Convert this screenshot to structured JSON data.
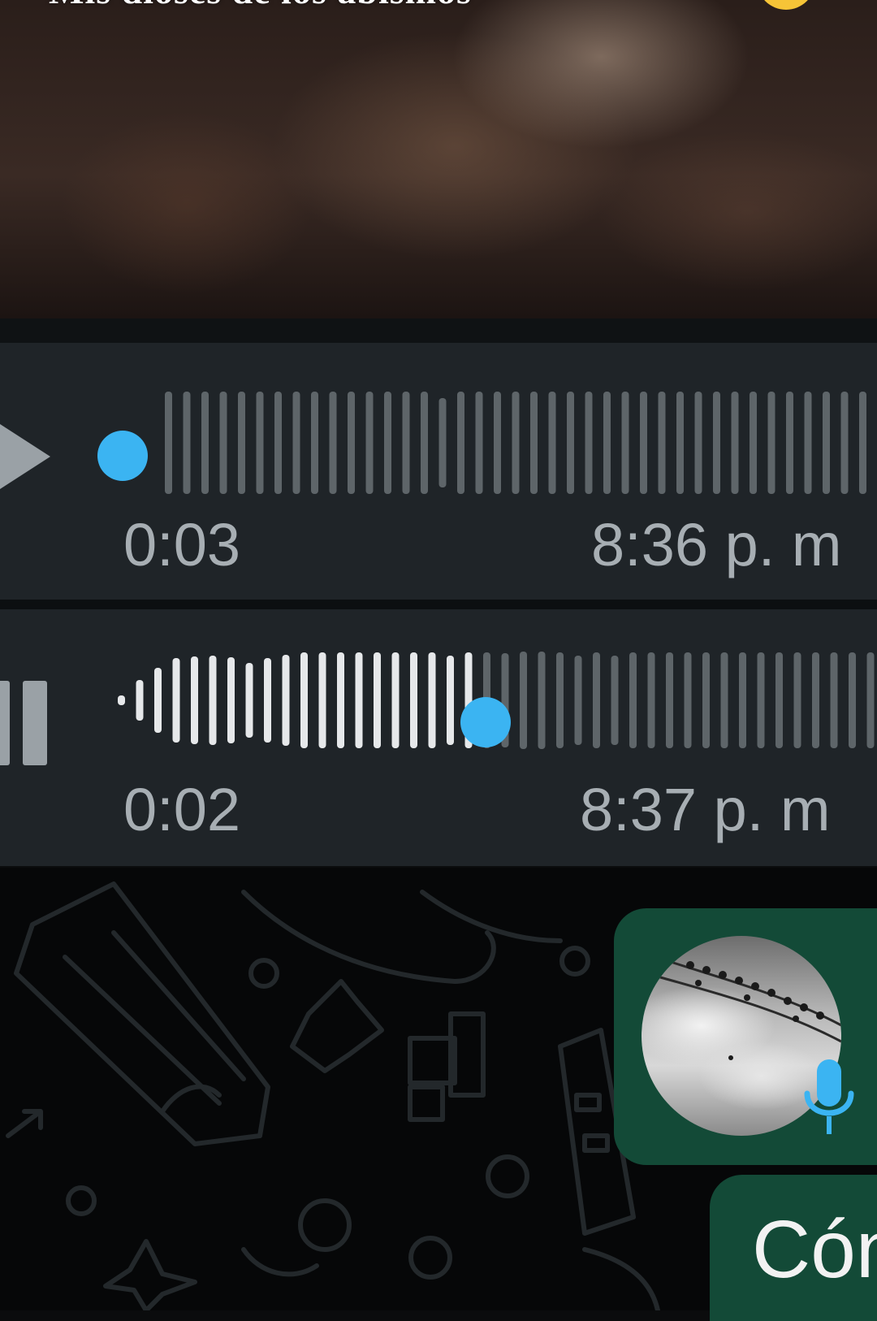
{
  "video_caption": {
    "text": "Mis dioses de los abismos",
    "emoji": "grinning-face-emoji"
  },
  "messages": [
    {
      "kind": "voice",
      "state": "paused",
      "duration": "0:03",
      "time": "8:36 p. m",
      "progress": 0.0
    },
    {
      "kind": "voice",
      "state": "playing",
      "duration": "0:02",
      "time": "8:37 p. m",
      "progress": 0.48
    }
  ],
  "outgoing": {
    "audio": {
      "thumbnail": "profile-photo-birds-on-wire",
      "icon": "microphone-icon"
    },
    "text_partial": "Cón"
  },
  "colors": {
    "bubble_in": "#1f2428",
    "bubble_out": "#134a37",
    "accent": "#3bb4f2",
    "wave_played": "#e6e8ea",
    "wave_unplayed": "#5e6569",
    "meta_text": "#a7aeb3"
  }
}
